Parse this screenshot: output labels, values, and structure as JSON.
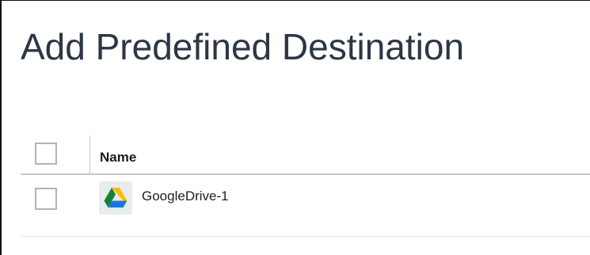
{
  "page": {
    "title": "Add Predefined Destination"
  },
  "table": {
    "columns": [
      {
        "label": "Name"
      }
    ],
    "rows": [
      {
        "name": "GoogleDrive-1",
        "icon": "google-drive-icon",
        "checked": false
      }
    ]
  },
  "colors": {
    "title_text": "#2d3645",
    "header_rule": "#c8c8c8",
    "checkbox_border": "#b3b3b3",
    "icon_tile": "#e9ecef"
  }
}
